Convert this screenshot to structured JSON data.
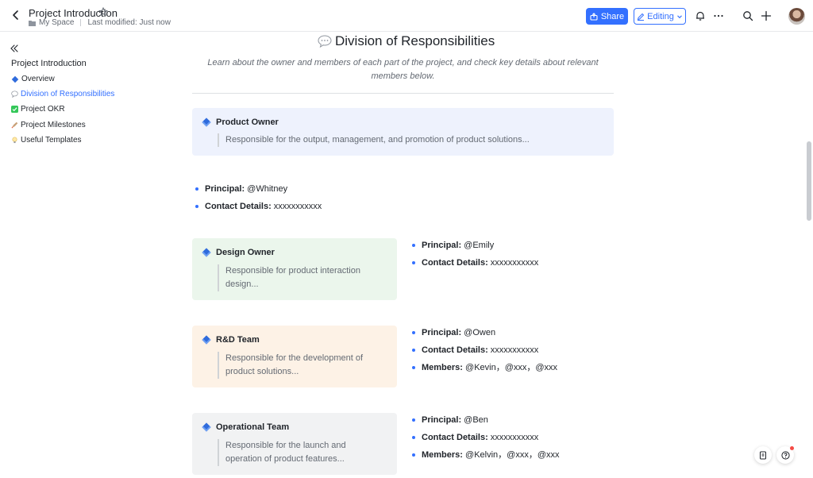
{
  "header": {
    "title": "Project Introduction",
    "location": "My Space",
    "last_modified": "Last modified: Just now",
    "share_label": "Share",
    "editing_label": "Editing",
    "accent_color": "#3370ff"
  },
  "sidebar": {
    "outline_title": "Project Introduction",
    "items": [
      {
        "label": "Overview",
        "icon": "blue-diamond-icon"
      },
      {
        "label": "Division of Responsibilities",
        "icon": "speech-bubble-icon",
        "active": true
      },
      {
        "label": "Project OKR",
        "icon": "check-mark-icon"
      },
      {
        "label": "Project Milestones",
        "icon": "rocket-icon"
      },
      {
        "label": "Useful Templates",
        "icon": "lightbulb-icon"
      }
    ]
  },
  "main": {
    "section_title": "Division of Responsibilities",
    "intro": "Learn about the owner and members of each part of the project, and check key details about relevant members below.",
    "cards": [
      {
        "title": "Product Owner",
        "description": "Responsible for the output, management, and promotion of product solutions...",
        "background": "#eef2fd",
        "details": [
          {
            "key": "Principal:",
            "value": " @Whitney"
          },
          {
            "key": "Contact Details:",
            "value": " xxxxxxxxxxx"
          }
        ]
      },
      {
        "title": "Design Owner",
        "description": "Responsible for product interaction design...",
        "background": "#ebf6ec",
        "details": [
          {
            "key": "Principal:",
            "value": " @Emily"
          },
          {
            "key": "Contact Details:",
            "value": " xxxxxxxxxxx"
          }
        ]
      },
      {
        "title": "R&D Team",
        "description": "Responsible for the development of product solutions...",
        "background": "#fdf2e6",
        "details": [
          {
            "key": "Principal:",
            "value": " @Owen"
          },
          {
            "key": "Contact Details:",
            "value": " xxxxxxxxxxx"
          },
          {
            "key": "Members:",
            "value": " @Kevin，@xxx，@xxx"
          }
        ]
      },
      {
        "title": "Operational Team",
        "description": "Responsible for the launch and operation of product features...",
        "background": "#f1f2f3",
        "details": [
          {
            "key": "Principal:",
            "value": " @Ben"
          },
          {
            "key": "Contact Details:",
            "value": " xxxxxxxxxxx"
          },
          {
            "key": "Members:",
            "value": " @Kelvin，@xxx，@xxx"
          }
        ]
      }
    ]
  }
}
